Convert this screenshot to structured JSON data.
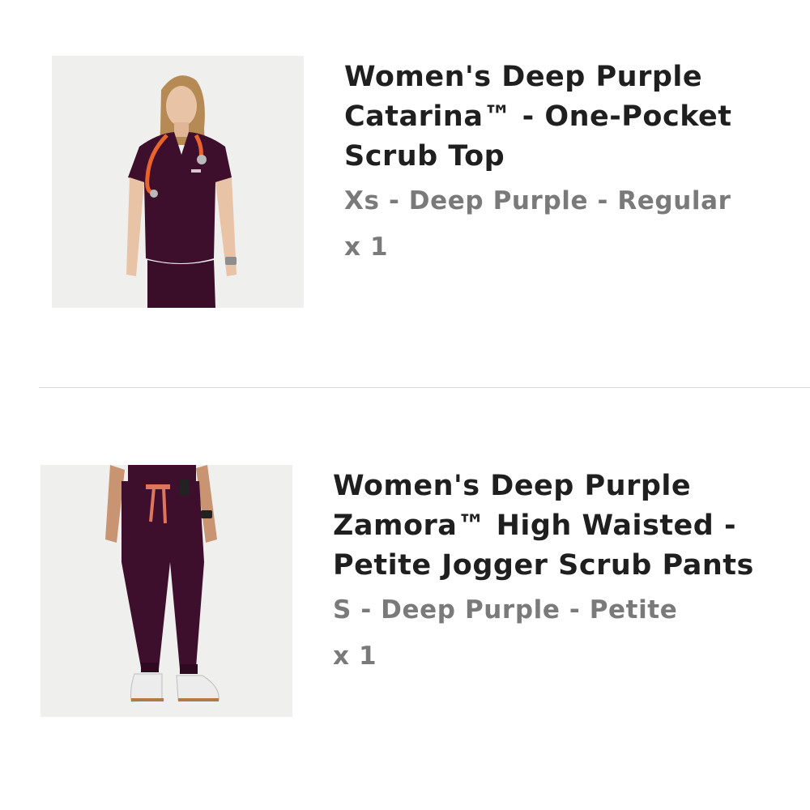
{
  "items": [
    {
      "title": "Women's Deep Purple\nCatarina™ - One-Pocket\nScrub Top",
      "variant": "Xs - Deep Purple - Regular",
      "quantity": "x 1",
      "image_alt": "Model wearing deep purple one-pocket scrub top with stethoscope",
      "color": "#3e0f2c"
    },
    {
      "title": "Women's Deep Purple\nZamora™ High Waisted -\nPetite Jogger Scrub Pants",
      "variant": "S - Deep Purple - Petite",
      "quantity": "x 1",
      "image_alt": "Model wearing deep purple high waisted jogger scrub pants",
      "color": "#3e0f2c"
    }
  ],
  "colors": {
    "title_text": "#1f1f1f",
    "secondary_text": "#7a7a7a",
    "divider": "#d9d9d9",
    "image_background": "#efefee",
    "accent_edge": "#c0392b"
  }
}
